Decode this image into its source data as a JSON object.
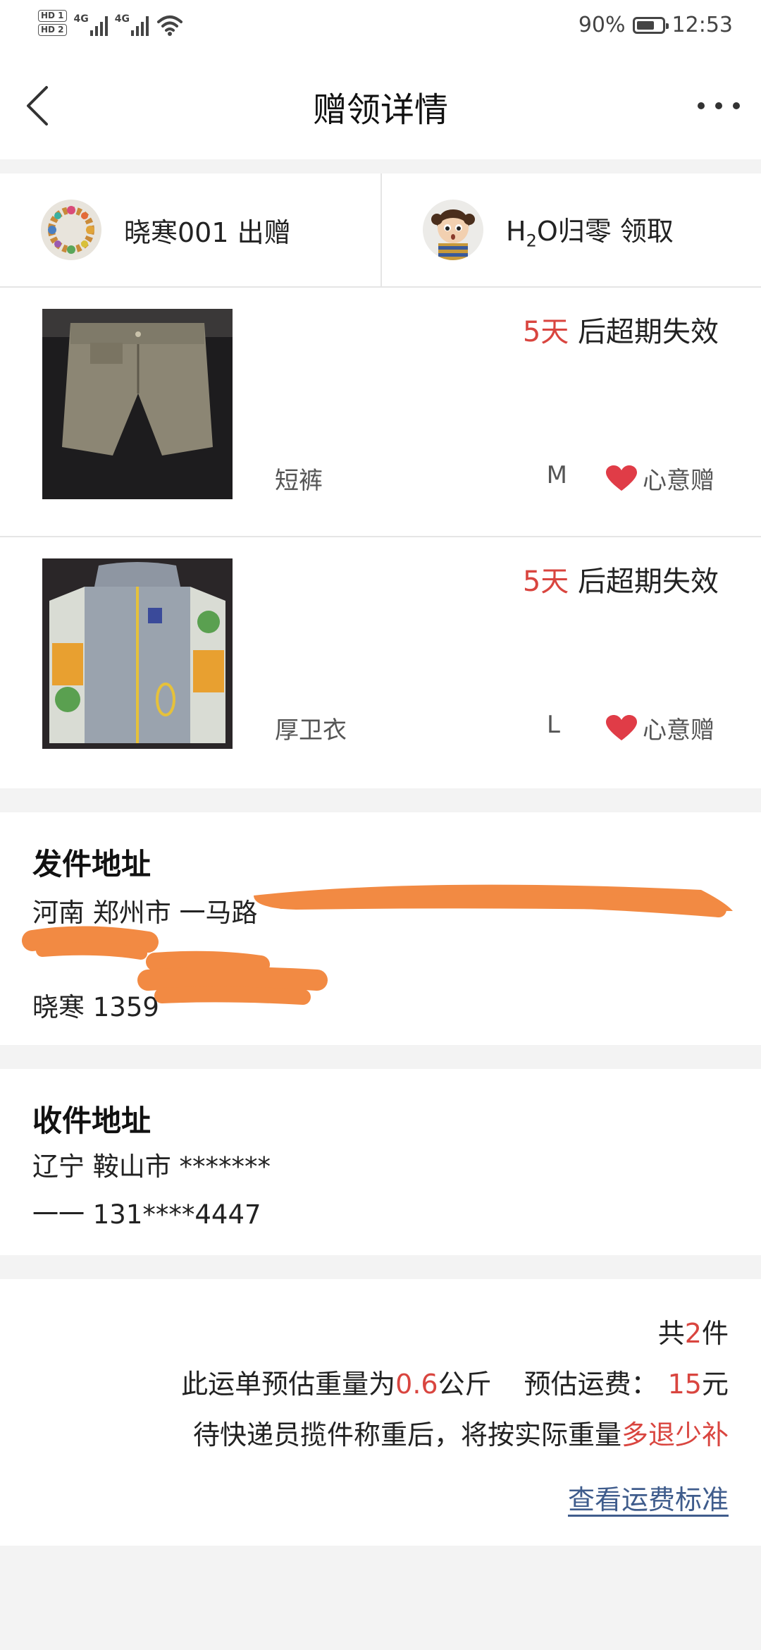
{
  "status_bar": {
    "sim_labels": [
      "HD 1",
      "HD 2"
    ],
    "network": [
      "4G",
      "4G"
    ],
    "battery_percent": "90%",
    "battery_level": 0.9,
    "time": "12:53"
  },
  "nav": {
    "title": "赠领详情"
  },
  "parties": {
    "giver": {
      "name": "晓寒001 出赠"
    },
    "receiver": {
      "name_prefix": "H",
      "name_sub": "2",
      "name_suffix": "O归零 领取"
    }
  },
  "items": [
    {
      "expire_days": "5天",
      "expire_suffix": " 后超期失效",
      "name": "短裤",
      "size": "M",
      "gift_type": "心意赠"
    },
    {
      "expire_days": "5天",
      "expire_suffix": " 后超期失效",
      "name": "厚卫衣",
      "size": "L",
      "gift_type": "心意赠"
    }
  ],
  "sender_address": {
    "title": "发件地址",
    "line1": "河南 郑州市 一马路",
    "line3": "晓寒 1359"
  },
  "receiver_address": {
    "title": "收件地址",
    "line1": "辽宁 鞍山市 *******",
    "line2": "一一 131****4447"
  },
  "summary": {
    "count_prefix": "共",
    "count": "2",
    "count_suffix": "件",
    "weight_prefix": "此运单预估重量为",
    "weight_value": "0.6",
    "weight_unit": "公斤",
    "fee_label": "预估运费：",
    "fee_value": "15",
    "fee_unit": "元",
    "note_prefix": "待快递员揽件称重后，将按实际重量",
    "note_highlight": "多退少补",
    "link_text": "查看运费标准"
  },
  "colors": {
    "accent_red": "#d9453f",
    "link_blue": "#3f5c8c",
    "redaction_orange": "#f28a43"
  }
}
